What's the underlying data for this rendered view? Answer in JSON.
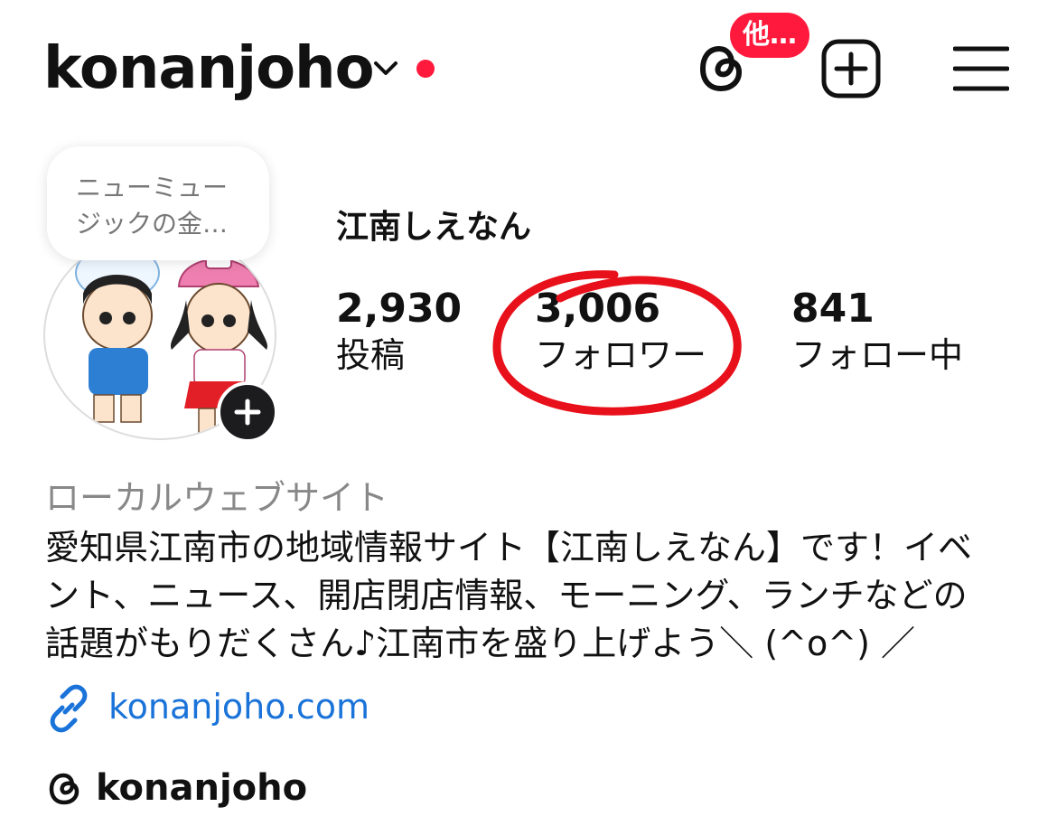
{
  "header": {
    "username": "konanjoho",
    "threads_badge": "他…"
  },
  "profile": {
    "note_line1": "ニューミュー",
    "note_line2": "ジックの金…",
    "full_name": "江南しえなん",
    "stats": [
      {
        "value": "2,930",
        "label": "投稿"
      },
      {
        "value": "3,006",
        "label": "フォロワー"
      },
      {
        "value": "841",
        "label": "フォロー中"
      }
    ],
    "category": "ローカルウェブサイト",
    "bio_lines": [
      "愛知県江南市の地域情報サイト【江南しえなん】です！イベ",
      "ント、ニュース、開店閉店情報、モーニング、ランチなどの",
      "話題がもりだくさん♪江南市を盛り上げよう＼ (^o^) ／"
    ],
    "link": "konanjoho.com",
    "threads_handle": "konanjoho"
  },
  "colors": {
    "accent_red": "#ff1a3d",
    "link_blue": "#1a73d9",
    "annotation_red": "#e8101a"
  }
}
